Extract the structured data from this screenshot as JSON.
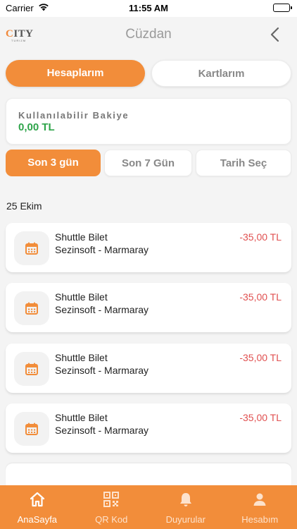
{
  "status_bar": {
    "carrier": "Carrier",
    "time": "11:55 AM"
  },
  "header": {
    "logo_text": "CITY",
    "logo_sub": "TURIZM",
    "title": "Cüzdan"
  },
  "tabs_main": [
    {
      "label": "Hesaplarım",
      "active": true
    },
    {
      "label": "Kartlarım",
      "active": false
    }
  ],
  "balance": {
    "label": "Kullanılabilir Bakiye",
    "value": "0,00 TL"
  },
  "range_tabs": [
    {
      "label": "Son 3 gün",
      "active": true
    },
    {
      "label": "Son 7 Gün",
      "active": false
    },
    {
      "label": "Tarih Seç",
      "active": false
    }
  ],
  "date_group": "25 Ekim",
  "transactions": [
    {
      "title": "Shuttle Bilet",
      "subtitle": "Sezinsoft - Marmaray",
      "amount": "-35,00 TL",
      "icon": "calendar-icon"
    },
    {
      "title": "Shuttle Bilet",
      "subtitle": "Sezinsoft - Marmaray",
      "amount": "-35,00 TL",
      "icon": "calendar-icon"
    },
    {
      "title": "Shuttle Bilet",
      "subtitle": "Sezinsoft - Marmaray",
      "amount": "-35,00 TL",
      "icon": "calendar-icon"
    },
    {
      "title": "Shuttle Bilet",
      "subtitle": "Sezinsoft - Marmaray",
      "amount": "-35,00 TL",
      "icon": "calendar-icon"
    }
  ],
  "bottom_nav": [
    {
      "label": "AnaSayfa",
      "icon": "home-icon",
      "active": true
    },
    {
      "label": "QR Kod",
      "icon": "qr-code-icon",
      "active": false
    },
    {
      "label": "Duyurular",
      "icon": "bell-icon",
      "active": false
    },
    {
      "label": "Hesabım",
      "icon": "user-icon",
      "active": false
    }
  ],
  "colors": {
    "accent": "#f28d3a",
    "positive": "#2ea44a",
    "negative": "#e05050"
  }
}
